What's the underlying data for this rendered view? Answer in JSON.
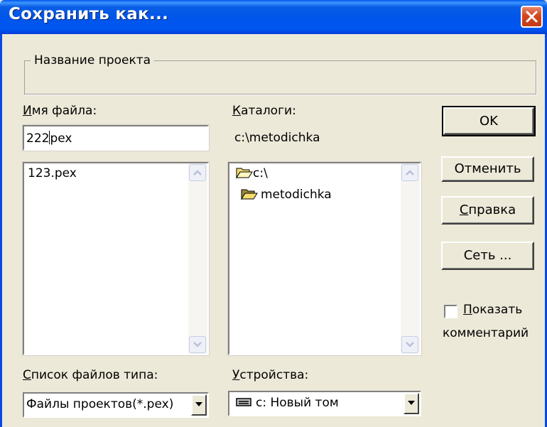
{
  "window": {
    "title": "Сохранить как...",
    "close_icon": "close-icon"
  },
  "project_group": {
    "label": "Название проекта"
  },
  "file_name": {
    "label_accel": "И",
    "label_rest": "мя файла:",
    "value_before_caret": "222",
    "value_after_caret": "pex"
  },
  "files_list": {
    "items": [
      "123.pex"
    ]
  },
  "directories": {
    "label_accel": "К",
    "label_rest": "аталоги:",
    "current_path": "c:\\metodichka",
    "items": [
      {
        "label": "c:\\",
        "icon": "open-folder-icon"
      },
      {
        "label": "metodichka",
        "icon": "open-folder-icon"
      }
    ]
  },
  "file_type": {
    "label_accel": "С",
    "label_rest": "писок файлов типа:",
    "selected": "Файлы проектов(*.pex)"
  },
  "drives": {
    "label_accel": "У",
    "label_rest": "стройства:",
    "selected": "c: Новый том",
    "icon": "drive-icon"
  },
  "buttons": {
    "ok": "OK",
    "cancel": "Отменить",
    "help_accel": "С",
    "help_rest": "правка",
    "network": "Сеть ..."
  },
  "show_comments": {
    "label_accel": "П",
    "label_rest": "оказать",
    "label_line2": "комментарий",
    "checked": false
  },
  "colors": {
    "titlebar": "#0055ea",
    "dialog_bg": "#ece9d8",
    "close_button": "#d6461f",
    "folder": "#f5dc6e"
  }
}
